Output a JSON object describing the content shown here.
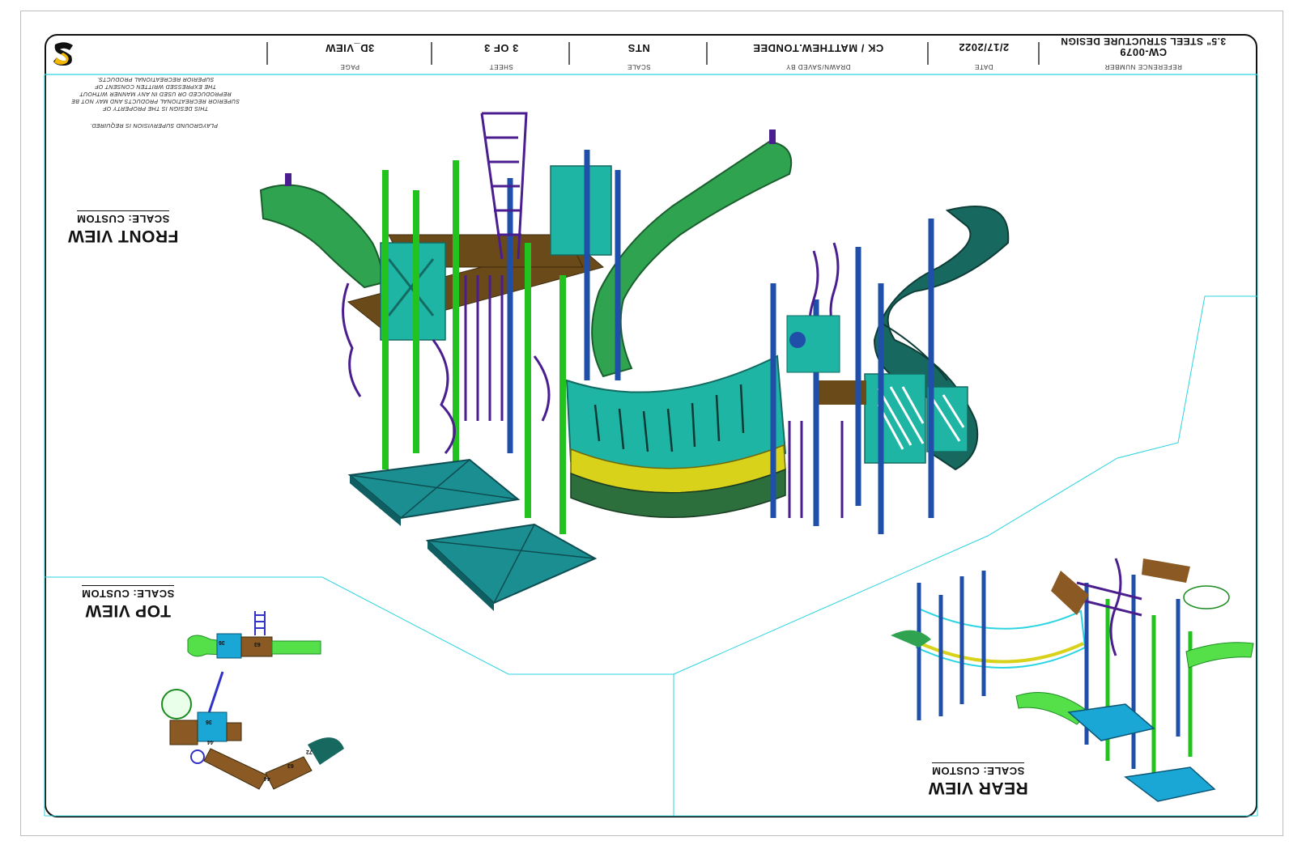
{
  "title_block": {
    "reference_number_label": "REFERENCE NUMBER",
    "reference_design": "3.5\" STEEL STRUCTURE DESIGN",
    "reference_code": "CW-0079",
    "date_label": "DATE",
    "date": "2/17/2022",
    "drawn_label": "DRAWN/SAVED BY",
    "drawn_by": "CK / MATTHEW.TONDEE",
    "scale_label": "SCALE",
    "scale": "NTS",
    "sheet_label": "SHEET",
    "sheet": "3 OF 3",
    "page_label": "PAGE",
    "page": "3D_VIEW"
  },
  "disclaimer": {
    "line1": "THIS DESIGN IS THE PROPERTY OF",
    "line2": "SUPERIOR RECREATIONAL PRODUCTS AND MAY NOT BE",
    "line3": "REPRODUCED OR USED IN ANY MANNER WITHOUT",
    "line4": "THE EXPRESSED WRITTEN CONSENT OF",
    "line5": "SUPERIOR RECREATIONAL PRODUCTS.",
    "supervision": "PLAYGROUND SUPERVISION IS REQUIRED."
  },
  "views": {
    "front": {
      "title": "FRONT VIEW",
      "scale": "SCALE: CUSTOM"
    },
    "top": {
      "title": "TOP VIEW",
      "scale": "SCALE: CUSTOM"
    },
    "rear": {
      "title": "REAR VIEW",
      "scale": "SCALE: CUSTOM"
    }
  },
  "deck_labels": {
    "d1": "36",
    "d2": "63",
    "d3": "36",
    "d4": "44",
    "d5": "44",
    "d6": "63",
    "d7": "72"
  },
  "colors": {
    "green_slide": "#2fa34f",
    "lime_post": "#22c21f",
    "blue_post": "#1f4fa8",
    "purple": "#4b1e8f",
    "teal_panel": "#1fb5a5",
    "dark_teal": "#17695f",
    "deck_brown": "#6b4a1a",
    "yellow": "#d9d21a",
    "cyan_line": "#2ad4e0",
    "logo_yellow": "#f5b800"
  }
}
